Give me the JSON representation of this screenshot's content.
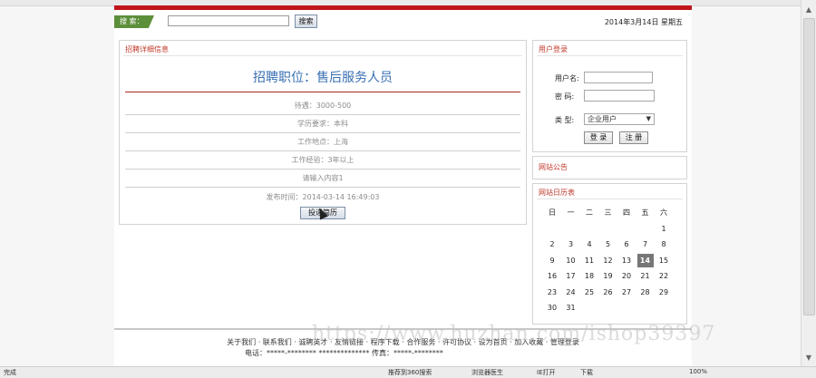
{
  "search": {
    "label": "搜 索：",
    "button": "搜索",
    "date": "2014年3月14日 星期五"
  },
  "job": {
    "panel_title": "招聘详细信息",
    "title": "招聘职位：售后服务人员",
    "salary": "待遇：3000-500",
    "education": "学历要求：本科",
    "location": "工作地点：上海",
    "experience": "工作经验：3年以上",
    "content": "请输入内容1",
    "published": "发布时间：2014-03-14 16:49:03",
    "apply_button": "投递简历"
  },
  "login": {
    "panel_title": "用户登录",
    "username_label": "用户名:",
    "password_label": "密  码:",
    "type_label": "类  型:",
    "type_value": "企业用户",
    "login_button": "登 录",
    "register_button": "注 册"
  },
  "notice": {
    "panel_title": "网站公告"
  },
  "calendar": {
    "panel_title": "网站日历表",
    "weekdays": [
      "日",
      "一",
      "二",
      "三",
      "四",
      "五",
      "六"
    ],
    "weeks": [
      [
        "",
        "",
        "",
        "",
        "",
        "",
        "1"
      ],
      [
        "2",
        "3",
        "4",
        "5",
        "6",
        "7",
        "8"
      ],
      [
        "9",
        "10",
        "11",
        "12",
        "13",
        "14",
        "15"
      ],
      [
        "16",
        "17",
        "18",
        "19",
        "20",
        "21",
        "22"
      ],
      [
        "23",
        "24",
        "25",
        "26",
        "27",
        "28",
        "29"
      ],
      [
        "30",
        "31",
        "",
        "",
        "",
        "",
        ""
      ]
    ],
    "today": "14"
  },
  "footer": {
    "links": "关于我们 · 联系我们 · 诚聘英才 · 友情链接 · 程序下载 · 合作服务 · 许可协议 · 设为首页 · 加入收藏 · 管理登录",
    "contact": "电话：*****-********  **************  传真：*****-********"
  },
  "watermark": "https://www.huzhan.com/ishop39397",
  "statusbar": {
    "left": "完成",
    "search": "推荐到360搜索",
    "doctor": "浏览器医生",
    "ie": "IE打开",
    "download": "下载",
    "zoom": "100%"
  }
}
